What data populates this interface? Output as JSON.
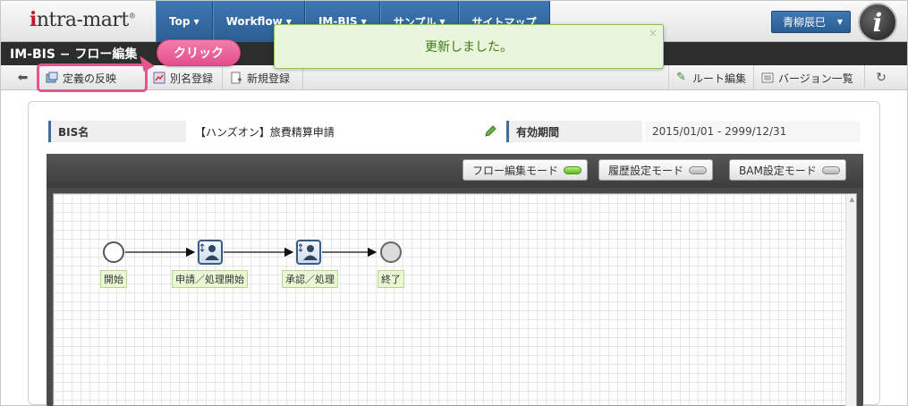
{
  "app": {
    "logo_text": "intra-mart",
    "nav": [
      {
        "label": "Top"
      },
      {
        "label": "Workflow"
      },
      {
        "label": "IM-BIS"
      },
      {
        "label": "サンプル"
      },
      {
        "label": "サイトマップ"
      }
    ],
    "user_name": "青柳辰巳"
  },
  "page": {
    "title": "IM-BIS − フロー編集"
  },
  "toolbar": {
    "apply_label": "定義の反映",
    "alias_label": "別名登録",
    "new_label": "新規登録",
    "route_edit_label": "ルート編集",
    "version_list_label": "バージョン一覧"
  },
  "callout": {
    "text": "クリック"
  },
  "toast": {
    "message": "更新しました。",
    "close": "×"
  },
  "info": {
    "bis_name_label": "BIS名",
    "bis_name_value": "【ハンズオン】旅費精算申請",
    "period_label": "有効期間",
    "period_value": "2015/01/01 - 2999/12/31"
  },
  "modes": {
    "flow_edit": {
      "label": "フロー編集モード",
      "active": true
    },
    "history_setting": {
      "label": "履歴設定モード",
      "active": false
    },
    "bam_setting": {
      "label": "BAM設定モード",
      "active": false
    }
  },
  "flow": {
    "nodes": [
      {
        "type": "start",
        "label": "開始"
      },
      {
        "type": "task",
        "label": "申請／処理開始"
      },
      {
        "type": "task",
        "label": "承認／処理"
      },
      {
        "type": "end",
        "label": "終了"
      }
    ]
  },
  "colors": {
    "nav_blue": "#3a6ea5",
    "highlight_pink": "#e4558c",
    "toast_green": "#3f7a18",
    "led_on": "#62b51b"
  }
}
